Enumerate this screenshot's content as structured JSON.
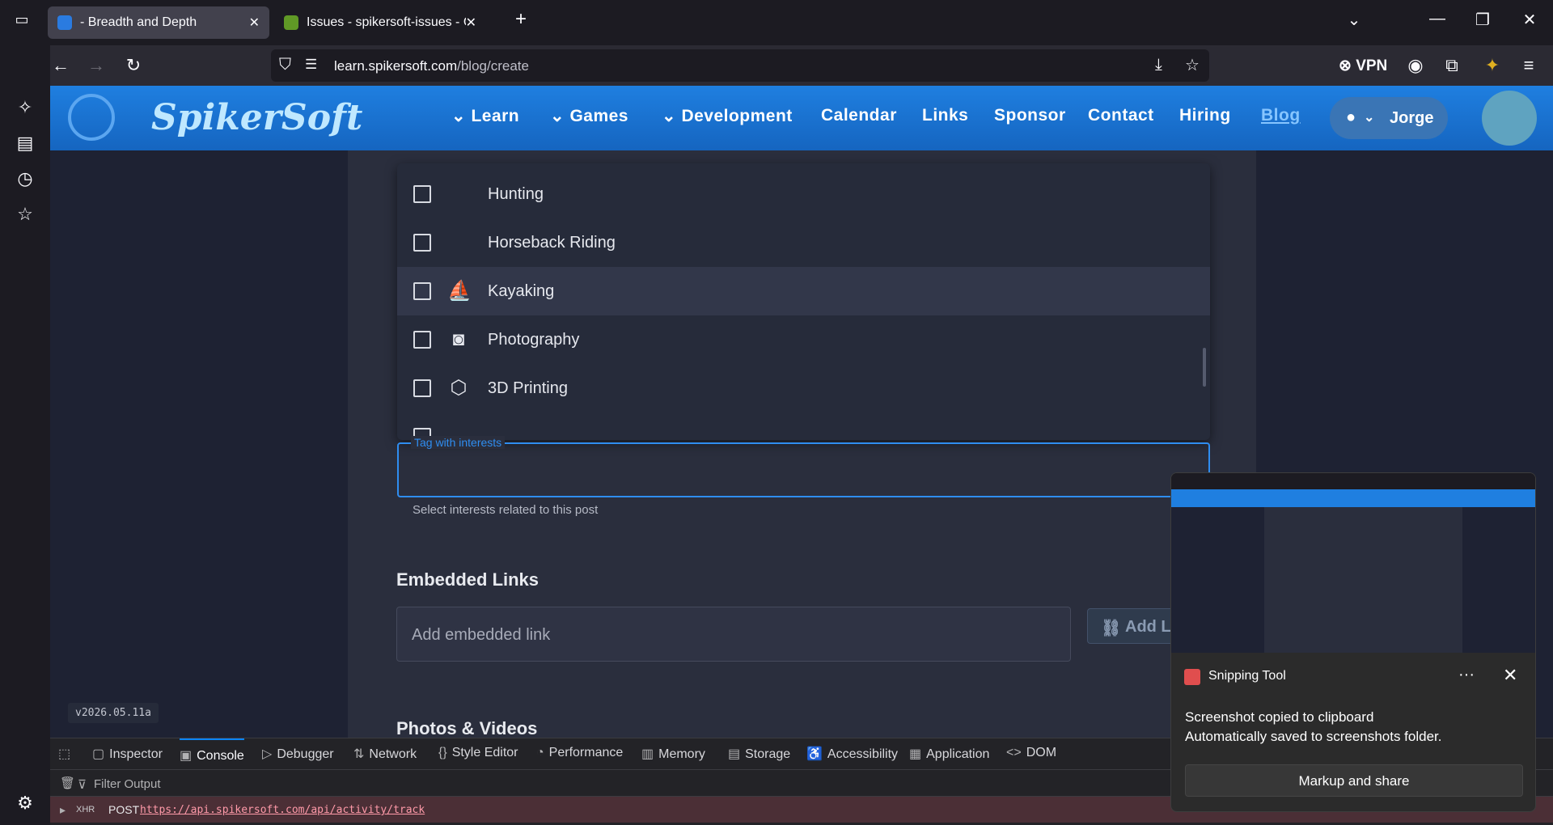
{
  "browser": {
    "tabs": [
      {
        "title": "- Breadth and Depth",
        "active": true
      },
      {
        "title": "Issues - spikersoft-issues - Gitea",
        "active": false
      }
    ],
    "new_tab_icon": "+",
    "url_host": "learn.spikersoft.com",
    "url_path": "/blog/create",
    "vpn_label": "VPN"
  },
  "site": {
    "logo": "SpikerSoft",
    "menu": [
      {
        "label": "Learn",
        "dropdown": true
      },
      {
        "label": "Games",
        "dropdown": true
      },
      {
        "label": "Development",
        "dropdown": true
      },
      {
        "label": "Calendar",
        "dropdown": false
      },
      {
        "label": "Links",
        "dropdown": false
      },
      {
        "label": "Sponsor",
        "dropdown": false
      },
      {
        "label": "Contact",
        "dropdown": false
      },
      {
        "label": "Hiring",
        "dropdown": false
      },
      {
        "label": "Blog",
        "dropdown": false,
        "active": true
      }
    ],
    "user": "Jorge",
    "version": "v2026.05.11a"
  },
  "interests": {
    "options": [
      {
        "label": "Hunting",
        "icon": "none",
        "checked": false
      },
      {
        "label": "Horseback Riding",
        "icon": "none",
        "checked": false
      },
      {
        "label": "Kayaking",
        "icon": "kayak-icon",
        "checked": false,
        "highlighted": true
      },
      {
        "label": "Photography",
        "icon": "camera-icon",
        "checked": false
      },
      {
        "label": "3D Printing",
        "icon": "cube-icon",
        "checked": false
      }
    ],
    "field_label": "Tag with interests",
    "helper": "Select interests related to this post"
  },
  "embedded_links": {
    "heading": "Embedded Links",
    "placeholder": "Add embedded link",
    "add_label": "Add L"
  },
  "photos_heading": "Photos & Videos",
  "devtools": {
    "tabs": [
      "Inspector",
      "Console",
      "Debugger",
      "Network",
      "Style Editor",
      "Performance",
      "Memory",
      "Storage",
      "Accessibility",
      "Application",
      "DOM"
    ],
    "active_tab": "Console",
    "filter_placeholder": "Filter Output",
    "log": {
      "badge": "XHR",
      "method": "POST",
      "url": "https://api.spikersoft.com/api/activity/track"
    }
  },
  "toast": {
    "app": "Snipping Tool",
    "title": "Screenshot copied to clipboard",
    "body": "Automatically saved to screenshots folder.",
    "button": "Markup and share",
    "more": "···"
  },
  "colors": {
    "accent": "#1f7fe0",
    "focus": "#2f8df0",
    "page_bg": "#1e2233"
  }
}
